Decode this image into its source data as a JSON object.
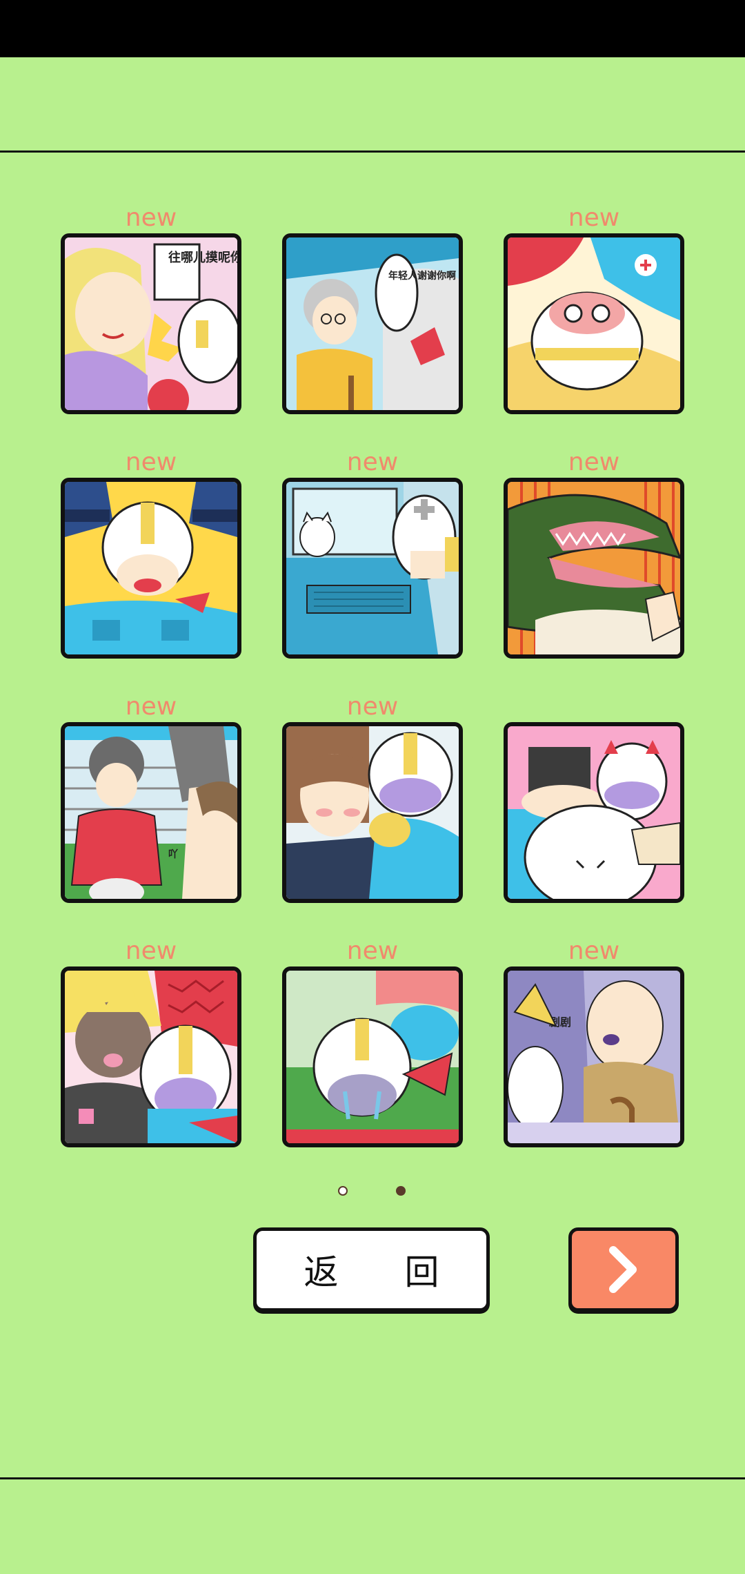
{
  "levels": [
    {
      "badge": "new",
      "scene": "blonde-woman-slapping",
      "speech": "往哪儿摸呢你这色狼！"
    },
    {
      "badge": "",
      "scene": "grandma-on-bus",
      "speech": "年轻人谢谢你啊"
    },
    {
      "badge": "new",
      "scene": "hero-fallen-upside-down",
      "speech": ""
    },
    {
      "badge": "new",
      "scene": "hero-crying-with-police",
      "speech": ""
    },
    {
      "badge": "new",
      "scene": "cat-on-car",
      "speech": ""
    },
    {
      "badge": "new",
      "scene": "crocodile-jaws",
      "speech": ""
    },
    {
      "badge": "new",
      "scene": "kimono-girl-stadium",
      "speech": "吖"
    },
    {
      "badge": "new",
      "scene": "office-lady-blushing",
      "speech": ""
    },
    {
      "badge": "",
      "scene": "man-with-red-cat-pink",
      "speech": ""
    },
    {
      "badge": "new",
      "scene": "blonde-man-and-hero",
      "speech": ""
    },
    {
      "badge": "new",
      "scene": "hero-crying-grass",
      "speech": ""
    },
    {
      "badge": "new",
      "scene": "old-man-with-cane",
      "speech": "剧剧"
    }
  ],
  "pagination": {
    "total": 2,
    "current": 2
  },
  "buttons": {
    "back_label": "返 回",
    "next_icon": "chevron-right-icon"
  },
  "colors": {
    "background": "#b8f08e",
    "badge": "#f08a6c",
    "next_button": "#f98866"
  }
}
